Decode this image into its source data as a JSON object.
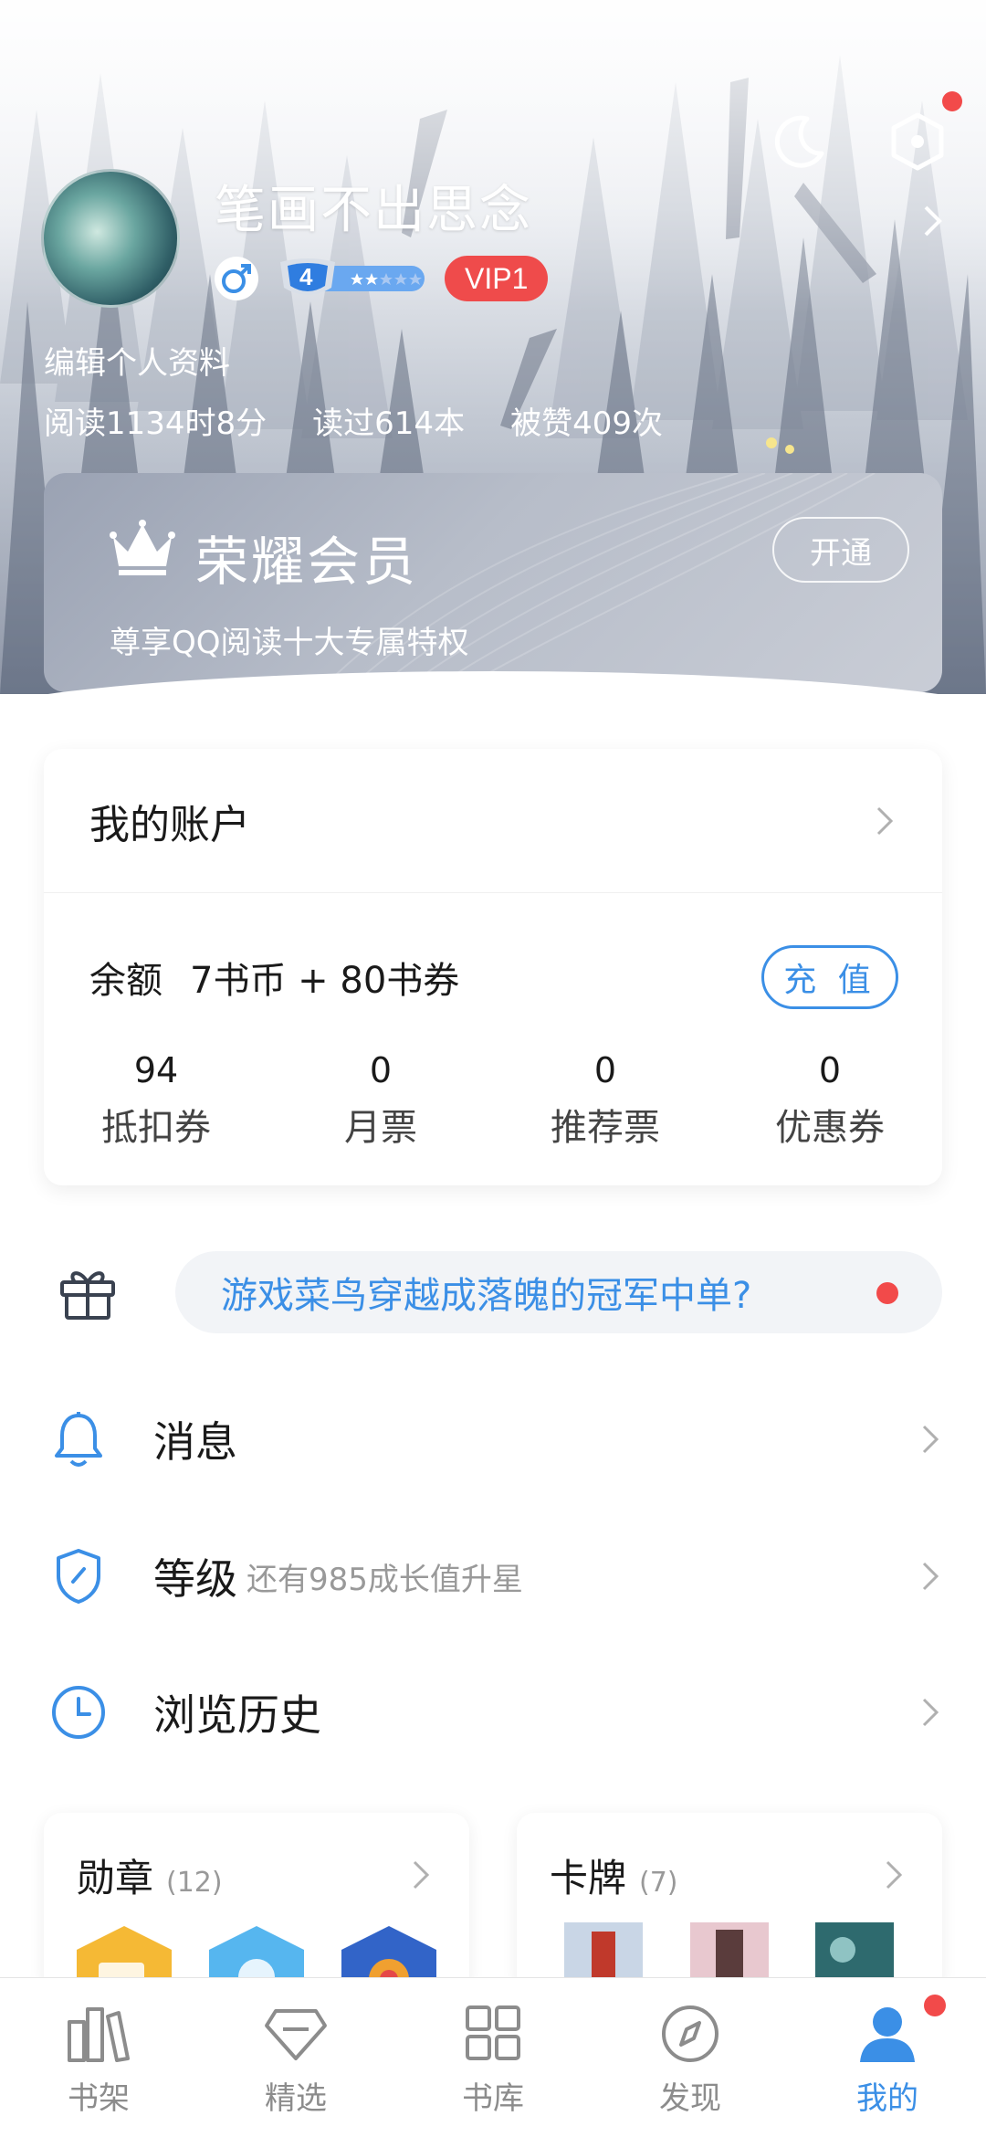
{
  "header": {
    "username": "笔画不出思念",
    "vip_label": "VIP1",
    "level_number": "4",
    "edit_profile": "编辑个人资料",
    "stats": [
      "阅读1134时8分",
      "读过614本",
      "被赞409次"
    ]
  },
  "vip_card": {
    "title": "荣耀会员",
    "subtitle": "尊享QQ阅读十大专属特权",
    "open_button": "开通"
  },
  "account": {
    "title": "我的账户",
    "balance_label": "余额",
    "balance_value": "7书币 + 80书券",
    "recharge_button": "充 值",
    "counts": [
      {
        "value": "94",
        "label": "抵扣券"
      },
      {
        "value": "0",
        "label": "月票"
      },
      {
        "value": "0",
        "label": "推荐票"
      },
      {
        "value": "0",
        "label": "优惠券"
      }
    ]
  },
  "promo": {
    "text": "游戏菜鸟穿越成落魄的冠军中单?"
  },
  "menu": {
    "messages": "消息",
    "level": "等级",
    "level_hint": "还有985成长值升星",
    "history": "浏览历史"
  },
  "medals": {
    "title": "勋章",
    "count": "(12)"
  },
  "cards": {
    "title": "卡牌",
    "count": "(7)"
  },
  "tabs": {
    "bookshelf": "书架",
    "featured": "精选",
    "library": "书库",
    "discover": "发现",
    "mine": "我的"
  },
  "colors": {
    "accent": "#3b8fe6",
    "vip_red": "#ef4b4b",
    "badge_dot": "#f24a4a"
  }
}
